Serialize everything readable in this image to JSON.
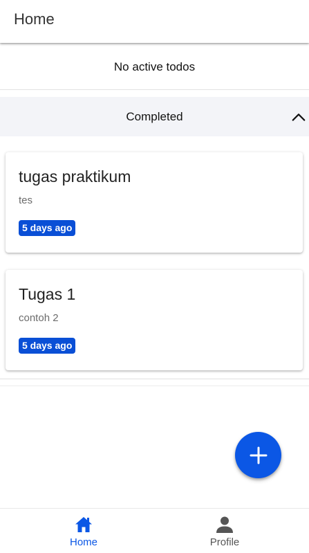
{
  "app_bar": {
    "title": "Home"
  },
  "active_section": {
    "empty_text": "No active todos"
  },
  "completed_section": {
    "label": "Completed",
    "toggle_icon": "chevron-up-icon"
  },
  "todos": [
    {
      "title": "tugas praktikum",
      "description": "tes",
      "time_badge": "5 days ago"
    },
    {
      "title": "Tugas 1",
      "description": "contoh 2",
      "time_badge": "5 days ago"
    }
  ],
  "fab": {
    "icon": "plus-icon"
  },
  "bottom_nav": {
    "items": [
      {
        "label": "Home",
        "icon": "home-icon",
        "active": true
      },
      {
        "label": "Profile",
        "icon": "person-icon",
        "active": false
      }
    ]
  },
  "colors": {
    "accent": "#0b57e5",
    "badge": "#0a4fd6",
    "section_bg": "#f3f4f8",
    "inactive_nav": "#555555"
  }
}
